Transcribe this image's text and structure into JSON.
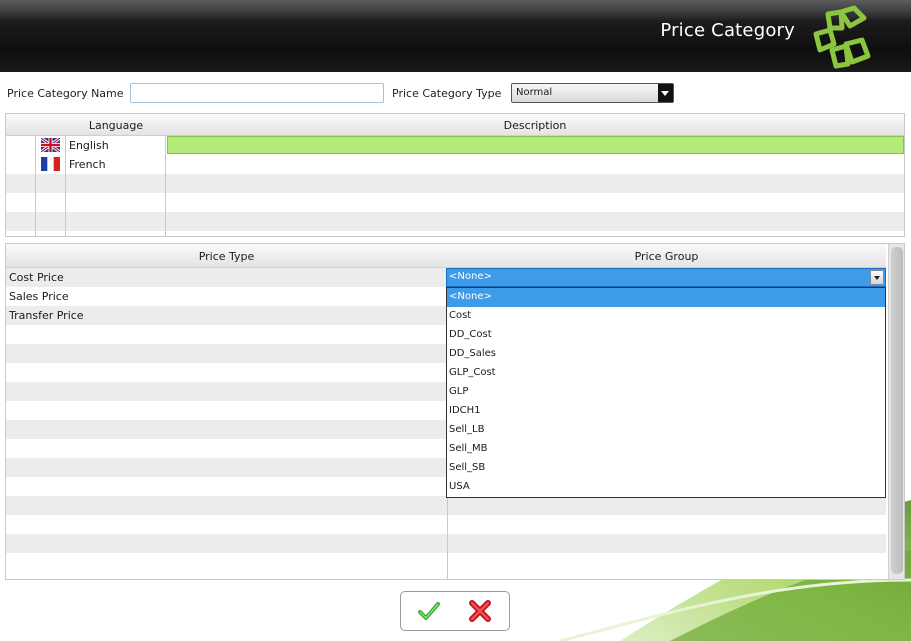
{
  "header": {
    "title": "Price Category",
    "logo_icon": "clover-logo-icon"
  },
  "form": {
    "name_label": "Price Category Name",
    "name_value": "",
    "type_label": "Price Category Type",
    "type_value": "Normal"
  },
  "language_grid": {
    "columns": [
      "Language",
      "Description"
    ],
    "rows": [
      {
        "language": "English",
        "flag": "uk-flag-icon",
        "description": ""
      },
      {
        "language": "French",
        "flag": "france-flag-icon",
        "description": ""
      }
    ]
  },
  "price_grid": {
    "columns": [
      "Price Type",
      "Price Group"
    ],
    "rows": [
      {
        "price_type": "Cost Price",
        "price_group": "<None>"
      },
      {
        "price_type": "Sales Price",
        "price_group": ""
      },
      {
        "price_type": "Transfer Price",
        "price_group": ""
      }
    ]
  },
  "price_group_dropdown": {
    "selected": "<None>",
    "options": [
      "<None>",
      "Cost",
      "DD_Cost",
      "DD_Sales",
      "GLP_Cost",
      "GLP",
      "IDCH1",
      "Sell_LB",
      "Sell_MB",
      "Sell_SB",
      "USA"
    ]
  },
  "actions": {
    "ok_icon": "checkmark-icon",
    "cancel_icon": "red-x-icon"
  },
  "colors": {
    "accent_green": "#8cc63f",
    "selection_blue": "#3d9be9",
    "header_dark": "#1a1a1a"
  }
}
